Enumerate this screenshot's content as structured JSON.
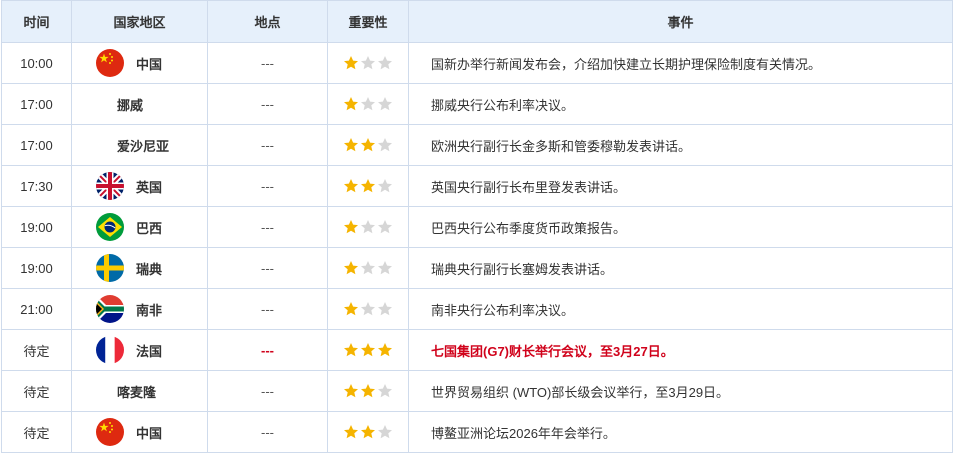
{
  "colors": {
    "star_on": "#f5b400",
    "star_off": "#d6d6d6",
    "highlight": "#d0021b"
  },
  "headers": {
    "time": "时间",
    "country": "国家地区",
    "place": "地点",
    "importance": "重要性",
    "event": "事件"
  },
  "rows": [
    {
      "time": "10:00",
      "country": "中国",
      "flag": "china-flag",
      "place": "---",
      "importance": 1,
      "event": "国新办举行新闻发布会，介绍加快建立长期护理保险制度有关情况。",
      "highlight": false
    },
    {
      "time": "17:00",
      "country": "挪威",
      "flag": "",
      "place": "---",
      "importance": 1,
      "event": "挪威央行公布利率决议。",
      "highlight": false
    },
    {
      "time": "17:00",
      "country": "爱沙尼亚",
      "flag": "",
      "place": "---",
      "importance": 2,
      "event": "欧洲央行副行长金多斯和管委穆勒发表讲话。",
      "highlight": false
    },
    {
      "time": "17:30",
      "country": "英国",
      "flag": "uk-flag",
      "place": "---",
      "importance": 2,
      "event": "英国央行副行长布里登发表讲话。",
      "highlight": false
    },
    {
      "time": "19:00",
      "country": "巴西",
      "flag": "brazil-flag",
      "place": "---",
      "importance": 1,
      "event": "巴西央行公布季度货币政策报告。",
      "highlight": false
    },
    {
      "time": "19:00",
      "country": "瑞典",
      "flag": "sweden-flag",
      "place": "---",
      "importance": 1,
      "event": "瑞典央行副行长塞姆发表讲话。",
      "highlight": false
    },
    {
      "time": "21:00",
      "country": "南非",
      "flag": "south-africa-flag",
      "place": "---",
      "importance": 1,
      "event": "南非央行公布利率决议。",
      "highlight": false
    },
    {
      "time": "待定",
      "country": "法国",
      "flag": "france-flag",
      "place": "---",
      "importance": 3,
      "event": "七国集团(G7)财长举行会议，至3月27日。",
      "highlight": true
    },
    {
      "time": "待定",
      "country": "喀麦隆",
      "flag": "",
      "place": "---",
      "importance": 2,
      "event": "世界贸易组织 (WTO)部长级会议举行，至3月29日。",
      "highlight": false
    },
    {
      "time": "待定",
      "country": "中国",
      "flag": "china-flag",
      "place": "---",
      "importance": 2,
      "event": "博鳌亚洲论坛2026年年会举行。",
      "highlight": false
    }
  ]
}
